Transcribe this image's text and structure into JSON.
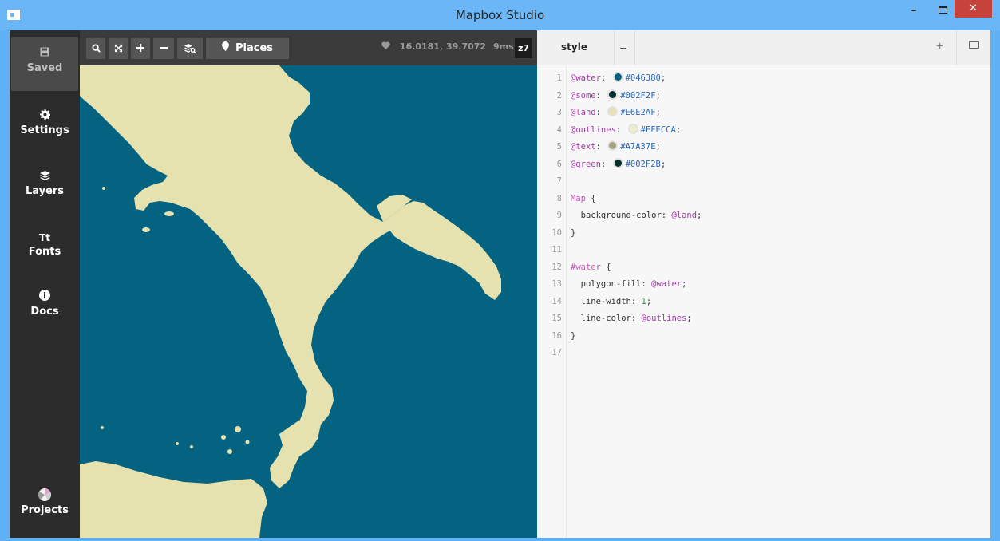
{
  "window": {
    "title": "Mapbox Studio",
    "minimize": "–",
    "close": "✕"
  },
  "sidebar": {
    "items": [
      {
        "label": "Saved",
        "icon": "save-icon"
      },
      {
        "label": "Settings",
        "icon": "gear-icon"
      },
      {
        "label": "Layers",
        "icon": "layers-icon"
      },
      {
        "label": "Fonts",
        "icon": "fonts-icon",
        "glyph": "Tt"
      },
      {
        "label": "Docs",
        "icon": "info-icon"
      },
      {
        "label": "Projects",
        "icon": "projects-icon"
      }
    ]
  },
  "toolbar": {
    "places_label": "Places",
    "coords": "16.0181, 39.7072",
    "render_time": "9ms",
    "zoom": "z7"
  },
  "editor": {
    "tab_label": "style",
    "lines": [
      {
        "n": "1",
        "parts": [
          [
            "var",
            "@water"
          ],
          [
            "txt",
            ": "
          ],
          [
            "sw",
            "#046380"
          ],
          [
            "hex",
            "#046380"
          ],
          [
            "txt",
            ";"
          ]
        ]
      },
      {
        "n": "2",
        "parts": [
          [
            "var",
            "@some"
          ],
          [
            "txt",
            ": "
          ],
          [
            "sw",
            "#002F2F"
          ],
          [
            "hex",
            "#002F2F"
          ],
          [
            "txt",
            ";"
          ]
        ]
      },
      {
        "n": "3",
        "parts": [
          [
            "var",
            "@land"
          ],
          [
            "txt",
            ": "
          ],
          [
            "sw",
            "#E6E2AF"
          ],
          [
            "hex",
            "#E6E2AF"
          ],
          [
            "txt",
            ";"
          ]
        ]
      },
      {
        "n": "4",
        "parts": [
          [
            "var",
            "@outlines"
          ],
          [
            "txt",
            ": "
          ],
          [
            "sw",
            "#EFECCA"
          ],
          [
            "hex",
            "#EFECCA"
          ],
          [
            "txt",
            ";"
          ]
        ]
      },
      {
        "n": "5",
        "parts": [
          [
            "var",
            "@text"
          ],
          [
            "txt",
            ": "
          ],
          [
            "sw",
            "#A7A37E"
          ],
          [
            "hex",
            "#A7A37E"
          ],
          [
            "txt",
            ";"
          ]
        ]
      },
      {
        "n": "6",
        "parts": [
          [
            "var",
            "@green"
          ],
          [
            "txt",
            ": "
          ],
          [
            "sw",
            "#002F2B"
          ],
          [
            "hex",
            "#002F2B"
          ],
          [
            "txt",
            ";"
          ]
        ]
      },
      {
        "n": "7",
        "parts": []
      },
      {
        "n": "8",
        "parts": [
          [
            "sel",
            "Map"
          ],
          [
            "txt",
            " {"
          ]
        ]
      },
      {
        "n": "9",
        "parts": [
          [
            "txt",
            "  background-color: "
          ],
          [
            "var",
            "@land"
          ],
          [
            "txt",
            ";"
          ]
        ]
      },
      {
        "n": "10",
        "parts": [
          [
            "txt",
            "}"
          ]
        ]
      },
      {
        "n": "11",
        "parts": []
      },
      {
        "n": "12",
        "parts": [
          [
            "sel",
            "#water"
          ],
          [
            "txt",
            " {"
          ]
        ]
      },
      {
        "n": "13",
        "parts": [
          [
            "txt",
            "  polygon-fill: "
          ],
          [
            "var",
            "@water"
          ],
          [
            "txt",
            ";"
          ]
        ]
      },
      {
        "n": "14",
        "parts": [
          [
            "txt",
            "  line-width: "
          ],
          [
            "num",
            "1"
          ],
          [
            "txt",
            ";"
          ]
        ]
      },
      {
        "n": "15",
        "parts": [
          [
            "txt",
            "  line-color: "
          ],
          [
            "var",
            "@outlines"
          ],
          [
            "txt",
            ";"
          ]
        ]
      },
      {
        "n": "16",
        "parts": [
          [
            "txt",
            "}"
          ]
        ]
      },
      {
        "n": "17",
        "parts": []
      }
    ]
  },
  "colors": {
    "water": "#046380",
    "land": "#E6E2AF",
    "sidebar": "#2c2c2c",
    "titlebar": "#6ab6f7"
  }
}
